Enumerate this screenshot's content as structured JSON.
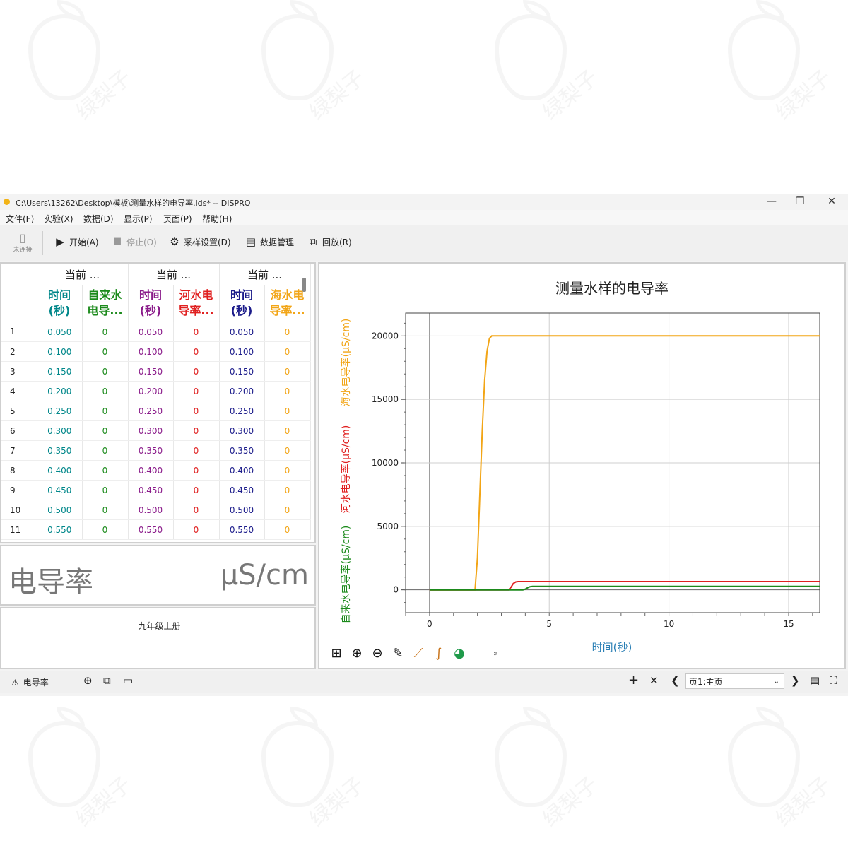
{
  "watermark": "绿梨子",
  "window": {
    "title": "C:\\Users\\13262\\Desktop\\模板\\测量水样的电导率.lds* -- DISPRO",
    "minimize": "—",
    "restore": "❐",
    "close": "✕"
  },
  "menu": [
    "文件(F)",
    "实验(X)",
    "数据(D)",
    "显示(P)",
    "页面(P)",
    "帮助(H)"
  ],
  "toolbar": {
    "connect_label": "未连接",
    "start": "开始(A)",
    "stop": "停止(O)",
    "sampling": "采样设置(D)",
    "data_manage": "数据管理",
    "playback": "回放(R)"
  },
  "table": {
    "groups": [
      "当前 ...",
      "当前 ...",
      "当前 ..."
    ],
    "headers": [
      {
        "text": "时间(秒)",
        "l1": "时间",
        "l2": "(秒)",
        "color": "#00878a"
      },
      {
        "text": "自来水电导...",
        "l1": "自来水",
        "l2": "电导...",
        "color": "#1b8a1b"
      },
      {
        "text": "时间(秒)",
        "l1": "时间",
        "l2": "(秒)",
        "color": "#8a1b8a"
      },
      {
        "text": "河水电导率...",
        "l1": "河水电",
        "l2": "导率...",
        "color": "#e02020"
      },
      {
        "text": "时间(秒)",
        "l1": "时间",
        "l2": "(秒)",
        "color": "#1b1b8a"
      },
      {
        "text": "海水电导率...",
        "l1": "海水电",
        "l2": "导率...",
        "color": "#f2a516"
      }
    ],
    "rows": [
      [
        "1",
        "0.050",
        "0",
        "0.050",
        "0",
        "0.050",
        "0"
      ],
      [
        "2",
        "0.100",
        "0",
        "0.100",
        "0",
        "0.100",
        "0"
      ],
      [
        "3",
        "0.150",
        "0",
        "0.150",
        "0",
        "0.150",
        "0"
      ],
      [
        "4",
        "0.200",
        "0",
        "0.200",
        "0",
        "0.200",
        "0"
      ],
      [
        "5",
        "0.250",
        "0",
        "0.250",
        "0",
        "0.250",
        "0"
      ],
      [
        "6",
        "0.300",
        "0",
        "0.300",
        "0",
        "0.300",
        "0"
      ],
      [
        "7",
        "0.350",
        "0",
        "0.350",
        "0",
        "0.350",
        "0"
      ],
      [
        "8",
        "0.400",
        "0",
        "0.400",
        "0",
        "0.400",
        "0"
      ],
      [
        "9",
        "0.450",
        "0",
        "0.450",
        "0",
        "0.450",
        "0"
      ],
      [
        "10",
        "0.500",
        "0",
        "0.500",
        "0",
        "0.500",
        "0"
      ],
      [
        "11",
        "0.550",
        "0",
        "0.550",
        "0",
        "0.550",
        "0"
      ]
    ]
  },
  "meter": {
    "label": "电导率",
    "unit": "μS/cm"
  },
  "textbox": {
    "text": "九年级上册"
  },
  "chart_data": {
    "type": "line",
    "title": "测量水样的电导率",
    "xlabel": "时间(秒)",
    "xlim": [
      -1,
      16.3
    ],
    "ylim": [
      -1800,
      21800
    ],
    "xticks": [
      0,
      5,
      10,
      15
    ],
    "yticks": [
      0,
      5000,
      10000,
      15000,
      20000
    ],
    "grid": true,
    "series": [
      {
        "name": "海水电导率(μS/cm)",
        "color": "#f2a516",
        "x": [
          0,
          1.9,
          2.0,
          2.1,
          2.2,
          2.3,
          2.4,
          2.5,
          2.6,
          16.3
        ],
        "y": [
          0,
          0,
          2500,
          7500,
          12500,
          16500,
          18800,
          19800,
          20000,
          20000
        ]
      },
      {
        "name": "河水电导率(μS/cm)",
        "color": "#e02020",
        "x": [
          0,
          1.9,
          3.3,
          3.4,
          3.5,
          3.6,
          3.7,
          16.3
        ],
        "y": [
          0,
          0,
          0,
          200,
          500,
          620,
          650,
          650
        ]
      },
      {
        "name": "自来水电导率(μS/cm)",
        "color": "#1b8a1b",
        "x": [
          0,
          3.9,
          4.0,
          4.1,
          4.2,
          4.3,
          16.3
        ],
        "y": [
          0,
          0,
          60,
          170,
          250,
          270,
          270
        ]
      }
    ],
    "chart_tools": [
      "fit-icon",
      "zoom-in-icon",
      "zoom-out-icon",
      "pencil-icon",
      "tangent-icon",
      "curve-fit-icon",
      "pie-icon"
    ],
    "more": "»"
  },
  "bottombar": {
    "tab_label": "电导率",
    "page_select": "页1:主页",
    "add": "+",
    "remove": "✕",
    "prev": "❮",
    "next": "❯"
  }
}
